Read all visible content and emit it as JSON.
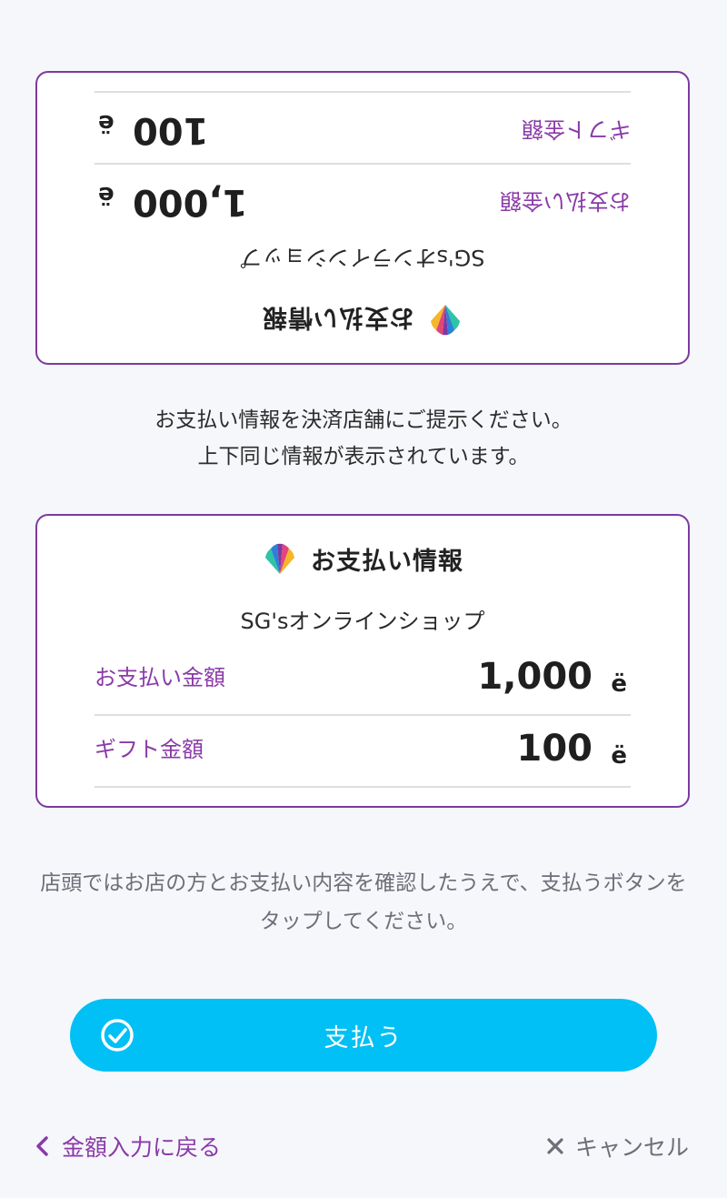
{
  "card": {
    "title": "お支払い情報",
    "shop": "SG'sオンラインショップ",
    "rows": [
      {
        "label": "お支払い金額",
        "value": "1,000",
        "unit": "ë"
      },
      {
        "label": "ギフト金額",
        "value": "100",
        "unit": "ë"
      }
    ]
  },
  "instructions": {
    "line1": "お支払い情報を決済店舗にご提示ください。",
    "line2": "上下同じ情報が表示されています。"
  },
  "note": "店頭ではお店の方とお支払い内容を確認したうえで、支払うボタンをタップしてください。",
  "pay_button": {
    "label": "支払う",
    "icon": "check-circle-icon"
  },
  "footer": {
    "back_label": "金額入力に戻る",
    "back_icon": "chevron-left-icon",
    "cancel_label": "キャンセル",
    "cancel_icon": "close-icon"
  },
  "colors": {
    "accent": "#8a3aa8",
    "border": "#7b3aa0",
    "button": "#00c0f5",
    "background": "#f6f7fb"
  }
}
